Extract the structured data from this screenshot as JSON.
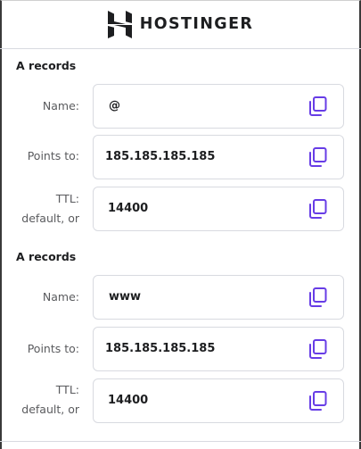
{
  "header": {
    "brand": "HOSTINGER",
    "logo_icon": "hostinger-logo-icon"
  },
  "sections": [
    {
      "title": "A records",
      "rows": [
        {
          "label": "Name:",
          "value": "@",
          "icon": "copy-icon"
        },
        {
          "label": "Points to:",
          "value": "185.185.185.185",
          "icon": "copy-icon"
        },
        {
          "label_line1": "TTL:",
          "label_line2": "default, or",
          "value": "14400",
          "icon": "copy-icon"
        }
      ]
    },
    {
      "title": "A records",
      "rows": [
        {
          "label": "Name:",
          "value": "www",
          "icon": "copy-icon"
        },
        {
          "label": "Points to:",
          "value": "185.185.185.185",
          "icon": "copy-icon"
        },
        {
          "label_line1": "TTL:",
          "label_line2": "default, or",
          "value": "14400",
          "icon": "copy-icon"
        }
      ]
    }
  ],
  "colors": {
    "accent": "#673de6",
    "text": "#1d1e20",
    "label": "#5a5b5e",
    "border": "#d8dae0"
  }
}
